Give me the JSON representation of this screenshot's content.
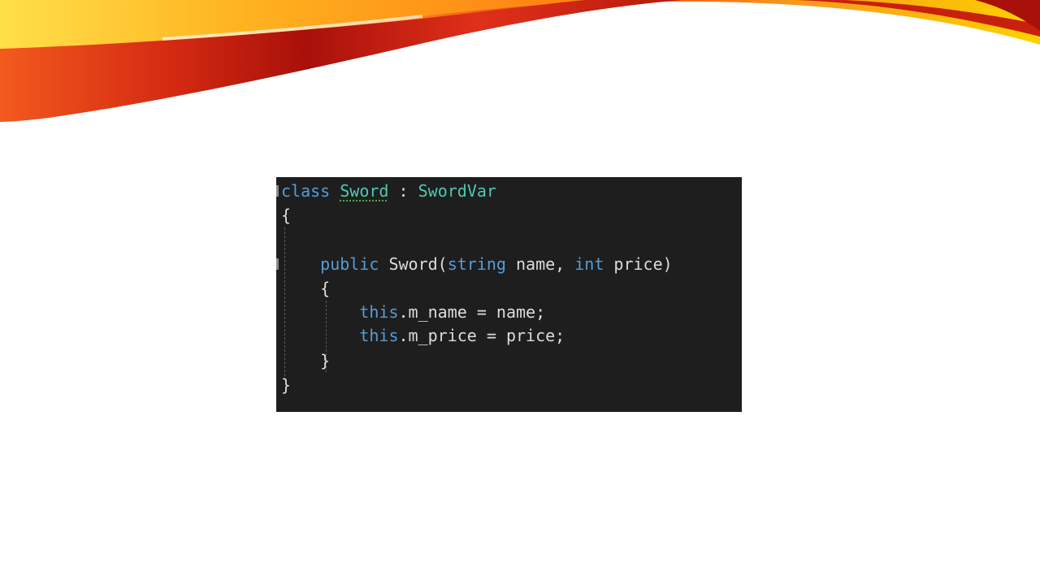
{
  "code": {
    "line1": {
      "kw_class": "class",
      "class_name": "Sword",
      "colon": " : ",
      "base_name": "SwordVar"
    },
    "line2": {
      "brace": "{"
    },
    "line4": {
      "indent": "    ",
      "kw_public": "public",
      "ctor_name": " Sword(",
      "kw_string": "string",
      "param1": " name, ",
      "kw_int": "int",
      "param2": " price)"
    },
    "line5": {
      "indent": "    ",
      "brace": "{"
    },
    "line6": {
      "indent": "        ",
      "kw_this": "this",
      "rest": ".m_name = name;"
    },
    "line7": {
      "indent": "        ",
      "kw_this": "this",
      "rest": ".m_price = price;"
    },
    "line8": {
      "indent": "    ",
      "brace": "}"
    },
    "line9": {
      "brace": "}"
    }
  },
  "colors": {
    "editor_background": "#1e1e1e",
    "keyword": "#569cd6",
    "type": "#4ec9b0",
    "identifier": "#dcdcdc",
    "swoosh_red": "#d42a12",
    "swoosh_orange": "#f7941d",
    "swoosh_yellow": "#ffd200"
  }
}
